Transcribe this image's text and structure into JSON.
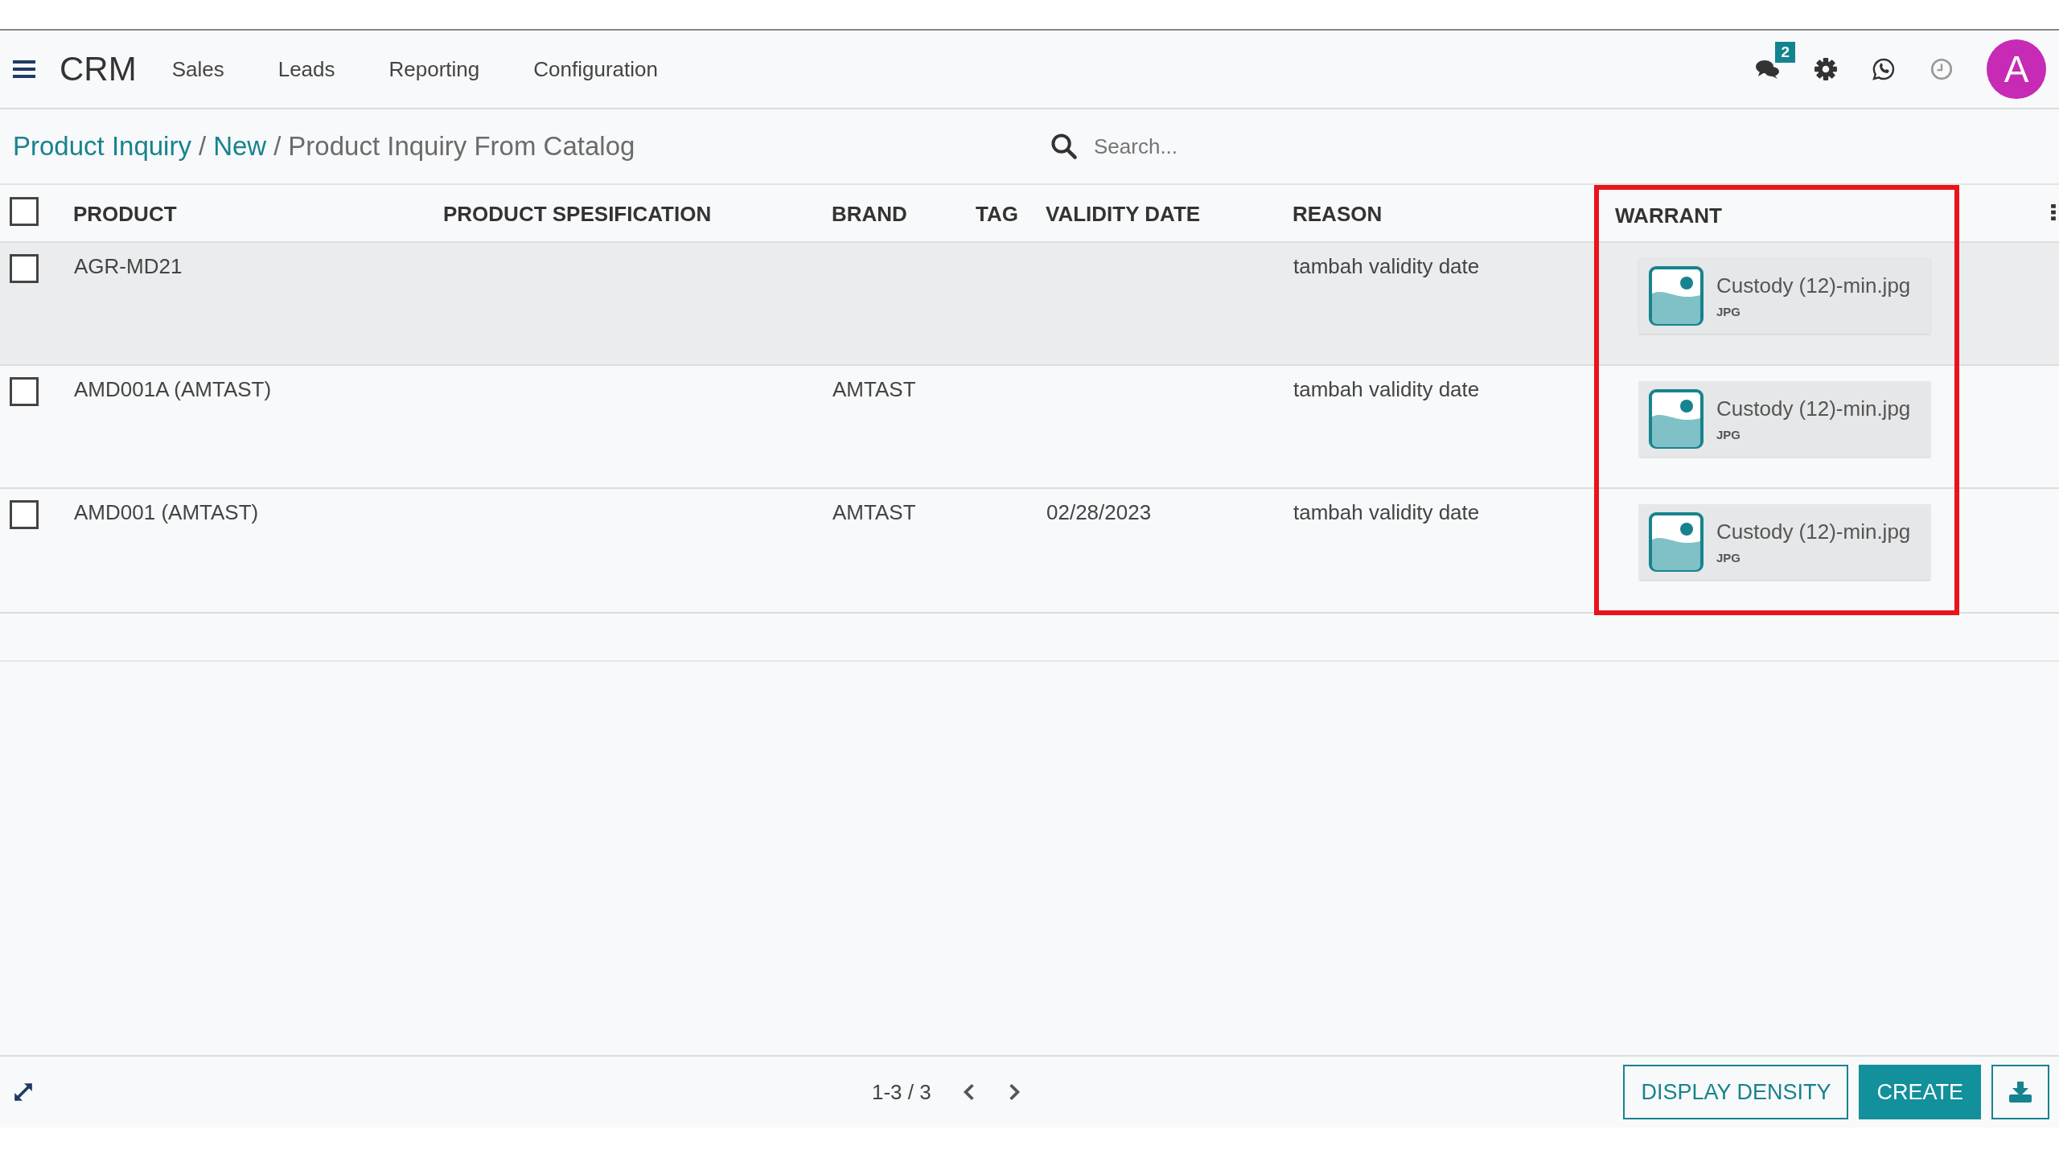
{
  "app": {
    "name": "CRM",
    "menu": [
      {
        "label": "Sales"
      },
      {
        "label": "Leads"
      },
      {
        "label": "Reporting"
      },
      {
        "label": "Configuration"
      }
    ]
  },
  "systray": {
    "message_count": "2",
    "avatar": "A"
  },
  "breadcrumb": [
    {
      "kind": "link",
      "label": "Product Inquiry"
    },
    {
      "kind": "separator",
      "label": "/"
    },
    {
      "kind": "link",
      "label": "New"
    },
    {
      "kind": "separator",
      "label": "/"
    },
    {
      "kind": "current",
      "label": "Product Inquiry From Catalog"
    }
  ],
  "search": {
    "placeholder": "Search..."
  },
  "table": {
    "select_all_checked": false,
    "columns": [
      {
        "label": "PRODUCT",
        "highlighted": false
      },
      {
        "label": "PRODUCT SPESIFICATION",
        "highlighted": false
      },
      {
        "label": "BRAND",
        "highlighted": false
      },
      {
        "label": "TAG",
        "highlighted": false
      },
      {
        "label": "VALIDITY DATE",
        "highlighted": false
      },
      {
        "label": "REASON",
        "highlighted": false
      },
      {
        "label": "WARRANT",
        "highlighted": true
      }
    ],
    "rows": [
      {
        "checked": false,
        "hovered": true,
        "product": "AGR-MD21",
        "brand": "",
        "validity_date": "",
        "reason": "tambah validity date",
        "warrant": {
          "filename": "Custody (12)-min.jpg",
          "type": "JPG"
        }
      },
      {
        "checked": false,
        "hovered": false,
        "product": "AMD001A (AMTAST)",
        "brand": "AMTAST",
        "validity_date": "",
        "reason": "tambah validity date",
        "warrant": {
          "filename": "Custody (12)-min.jpg",
          "type": "JPG"
        }
      },
      {
        "checked": false,
        "hovered": false,
        "product": "AMD001 (AMTAST)",
        "brand": "AMTAST",
        "validity_date": "02/28/2023",
        "reason": "tambah validity date",
        "warrant": {
          "filename": "Custody (12)-min.jpg",
          "type": "JPG"
        }
      }
    ]
  },
  "footer": {
    "pager": "1-3 / 3",
    "buttons": [
      {
        "kind": "outline",
        "label": "DISPLAY DENSITY"
      },
      {
        "kind": "primary",
        "label": "CREATE"
      }
    ]
  }
}
